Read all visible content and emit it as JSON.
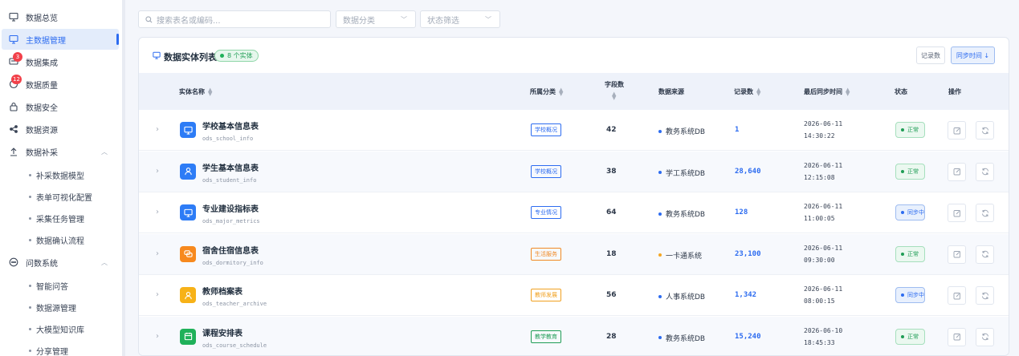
{
  "sidebar": {
    "items": [
      {
        "label": "数据总览",
        "icon": "monitor-icon"
      },
      {
        "label": "主数据管理",
        "icon": "database-screen-icon",
        "active": true
      },
      {
        "label": "数据集成",
        "icon": "integration-icon",
        "badge": "3"
      },
      {
        "label": "数据质量",
        "icon": "quality-icon",
        "badge": "12"
      },
      {
        "label": "数据安全",
        "icon": "lock-icon"
      },
      {
        "label": "数据资源",
        "icon": "share-icon"
      },
      {
        "label": "数据补采",
        "icon": "upload-icon",
        "expanded": true
      }
    ],
    "supplement_children": [
      "补采数据模型",
      "表单可视化配置",
      "采集任务管理",
      "数据确认流程"
    ],
    "qa_group": {
      "label": "问数系统",
      "icon": "chat-icon"
    },
    "qa_children": [
      "智能问答",
      "数据源管理",
      "大模型知识库",
      "分享管理"
    ]
  },
  "filters": {
    "search_placeholder": "搜索表名或编码...",
    "category_placeholder": "数据分类",
    "status_placeholder": "状态筛选"
  },
  "card": {
    "title": "数据实体列表",
    "entity_badge": "8 个实体",
    "btn_records": "记录数",
    "btn_sync_time": "同步时间 ↓"
  },
  "columns": {
    "name": "实体名称",
    "category": "所属分类",
    "fields": "字段数",
    "source": "数据来源",
    "records": "记录数",
    "last_sync": "最后同步时间",
    "status": "状态",
    "actions": "操作"
  },
  "rows": [
    {
      "name": "学校基本信息表",
      "code": "ods_school_info",
      "icon": "monitor-icon",
      "icon_color": "#2d7cf6",
      "category": "学校概况",
      "cat_color": "#2d6cf0",
      "fields": "42",
      "source": "教务系统DB",
      "source_dot": "#2d6cf0",
      "records": "1",
      "date": "2026-06-11",
      "time": "14:30:22",
      "status": "正常",
      "status_kind": "ok"
    },
    {
      "name": "学生基本信息表",
      "code": "ods_student_info",
      "icon": "user-icon",
      "icon_color": "#2d7cf6",
      "category": "学校概况",
      "cat_color": "#2d6cf0",
      "fields": "38",
      "source": "学工系统DB",
      "source_dot": "#2d6cf0",
      "records": "28,640",
      "date": "2026-06-11",
      "time": "12:15:08",
      "status": "正常",
      "status_kind": "ok"
    },
    {
      "name": "专业建设指标表",
      "code": "ods_major_metrics",
      "icon": "board-icon",
      "icon_color": "#2d7cf6",
      "category": "专业情况",
      "cat_color": "#2d6cf0",
      "fields": "64",
      "source": "教务系统DB",
      "source_dot": "#2d6cf0",
      "records": "128",
      "date": "2026-06-11",
      "time": "11:00:05",
      "status": "同步中",
      "status_kind": "sync"
    },
    {
      "name": "宿舍住宿信息表",
      "code": "ods_dormitory_info",
      "icon": "chat-bubbles-icon",
      "icon_color": "#f7891e",
      "category": "生活服务",
      "cat_color": "#f08a24",
      "fields": "18",
      "source": "一卡通系统",
      "source_dot": "#f5a623",
      "records": "23,100",
      "date": "2026-06-11",
      "time": "09:30:00",
      "status": "正常",
      "status_kind": "ok"
    },
    {
      "name": "教师档案表",
      "code": "ods_teacher_archive",
      "icon": "user-icon",
      "icon_color": "#f7b218",
      "category": "教师发展",
      "cat_color": "#f0a020",
      "fields": "56",
      "source": "人事系统DB",
      "source_dot": "#2d6cf0",
      "records": "1,342",
      "date": "2026-06-11",
      "time": "08:00:15",
      "status": "同步中",
      "status_kind": "sync"
    },
    {
      "name": "课程安排表",
      "code": "ods_course_schedule",
      "icon": "calendar-icon",
      "icon_color": "#1fb15a",
      "category": "教学教育",
      "cat_color": "#1f9d55",
      "fields": "28",
      "source": "教务系统DB",
      "source_dot": "#2d6cf0",
      "records": "15,240",
      "date": "2026-06-10",
      "time": "18:45:33",
      "status": "正常",
      "status_kind": "ok"
    }
  ]
}
